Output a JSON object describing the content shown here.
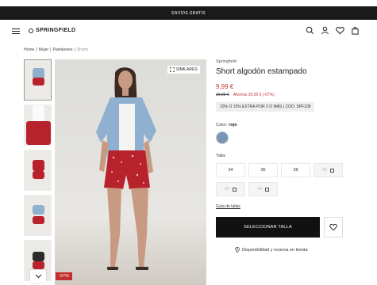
{
  "topbar": {
    "text": "ENVÍOS GRATIS"
  },
  "header": {
    "logo": "SPRINGFIELD",
    "icons": [
      "search-icon",
      "user-icon",
      "heart-icon",
      "bag-icon"
    ]
  },
  "breadcrumb": {
    "items": [
      "Home",
      "Mujer",
      "Pantalones",
      "Shorts"
    ]
  },
  "gallery": {
    "similares": "SIMILARES",
    "discount_badge": "-67%"
  },
  "product": {
    "brand": "Springfield",
    "title": "Short algodón estampado",
    "price": "9,99 €",
    "old_price": "29,99 €",
    "savings": "Ahorras 20,00 € (-67%)",
    "promo": "10% O 15% EXTRA POR 2 O MÁS | COD: SPF108",
    "color_label": "Color:",
    "color_value": "rojo",
    "swatch_color": "#7896b4",
    "size_label": "Talla:",
    "sizes": [
      {
        "label": "34",
        "available": true
      },
      {
        "label": "36",
        "available": true
      },
      {
        "label": "38",
        "available": true
      },
      {
        "label": "40",
        "available": false
      },
      {
        "label": "42",
        "available": false
      },
      {
        "label": "44",
        "available": false
      }
    ],
    "size_guide": "Guía de tallas",
    "select_button": "SELECCIONAR TALLA",
    "store_availability": "Disponibilidad y reserva en tienda"
  },
  "colors": {
    "accent": "#c1302f",
    "topbar": "#1a1a1a",
    "button": "#111111"
  }
}
